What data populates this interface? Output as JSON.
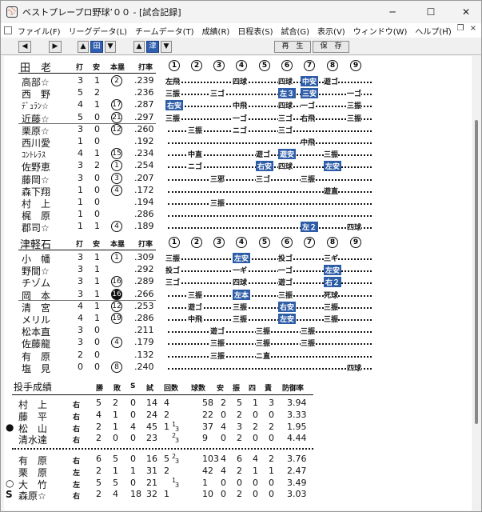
{
  "window": {
    "title": "ベストプレープロ野球’００ - [試合記録]",
    "icon": "baseball-cap-icon"
  },
  "menu": [
    "ファイル(F)",
    "リーグデータ(L)",
    "チームデータ(T)",
    "成績(R)",
    "日程表(S)",
    "試合(G)",
    "表示(V)",
    "ウィンドウ(W)",
    "ヘルプ(H)"
  ],
  "toolbar": {
    "team_a": "田",
    "team_b": "津",
    "replay": "再　生",
    "save": "保　存"
  },
  "headers": {
    "bat": "打",
    "hit": "安",
    "hr": "本塁",
    "avg": "打率"
  },
  "innings": [
    "1",
    "2",
    "3",
    "4",
    "5",
    "6",
    "7",
    "8",
    "9"
  ],
  "team_a": {
    "name": "田　老",
    "players": [
      {
        "name": "高部☆",
        "ab": "3",
        "h": "1",
        "hr": "2",
        "avg": ".239"
      },
      {
        "name": "西　野",
        "ab": "5",
        "h": "2",
        "hr": "",
        "avg": ".236"
      },
      {
        "name": "ﾃﾞｭﾗﾝ☆",
        "ab": "4",
        "h": "1",
        "hr": "17",
        "avg": ".287"
      },
      {
        "name": "近藤☆",
        "ab": "5",
        "h": "0",
        "hr": "21",
        "avg": ".297"
      },
      {
        "name": "栗原☆",
        "ab": "3",
        "h": "0",
        "hr": "12",
        "avg": ".260"
      },
      {
        "name": "西川愛",
        "ab": "1",
        "h": "0",
        "hr": "",
        "avg": ".192"
      },
      {
        "name": "ｺﾝﾄﾚﾗｽ",
        "ab": "4",
        "h": "1",
        "hr": "15",
        "avg": ".234"
      },
      {
        "name": "佐野恵",
        "ab": "3",
        "h": "2",
        "hr": "1",
        "avg": ".254"
      },
      {
        "name": "藤岡☆",
        "ab": "3",
        "h": "0",
        "hr": "3",
        "avg": ".207"
      },
      {
        "name": "森下翔",
        "ab": "1",
        "h": "0",
        "hr": "4",
        "avg": ".172"
      },
      {
        "name": "村　上",
        "ab": "1",
        "h": "0",
        "hr": "",
        "avg": ".194"
      },
      {
        "name": "梶　原",
        "ab": "1",
        "h": "0",
        "hr": "",
        "avg": ".286"
      },
      {
        "name": "郡司☆",
        "ab": "1",
        "h": "1",
        "hr": "4",
        "avg": ".189"
      }
    ]
  },
  "team_a_results": [
    [
      [
        "左飛",
        1,
        0
      ],
      [
        "四球",
        4,
        0
      ],
      [
        "四球",
        6,
        0
      ],
      [
        "中安",
        7,
        1
      ],
      [
        "遊ゴ",
        8,
        0
      ]
    ],
    [
      [
        "三振",
        1,
        0
      ],
      [
        "三ゴ",
        3,
        0
      ],
      [
        "左３",
        6,
        1
      ],
      [
        "三安",
        7,
        1
      ],
      [
        "一ゴ",
        9,
        0
      ]
    ],
    [
      [
        "右安",
        1,
        1
      ],
      [
        "中飛",
        4,
        0
      ],
      [
        "四球",
        6,
        0
      ],
      [
        "一ゴ",
        7,
        0
      ],
      [
        "三振",
        9,
        0
      ]
    ],
    [
      [
        "三振",
        1,
        0
      ],
      [
        "一ゴ",
        4,
        0
      ],
      [
        "三ゴ",
        6,
        0
      ],
      [
        "右飛",
        7,
        0
      ],
      [
        "三振",
        9,
        0
      ]
    ],
    [
      [
        "三振",
        2,
        0
      ],
      [
        "ニゴ",
        4,
        0
      ],
      [
        "三ゴ",
        6,
        0
      ]
    ],
    [
      [
        "中飛",
        7,
        0
      ]
    ],
    [
      [
        "中直",
        2,
        0
      ],
      [
        "遊ゴ",
        5,
        0
      ],
      [
        "遊安",
        6,
        1
      ],
      [
        "三振",
        8,
        0
      ]
    ],
    [
      [
        "ニゴ",
        2,
        0
      ],
      [
        "右安",
        5,
        1
      ],
      [
        "四球",
        6,
        0
      ],
      [
        "左安",
        8,
        1
      ]
    ],
    [
      [
        "三邪",
        3,
        0
      ],
      [
        "三ゴ",
        5,
        0
      ],
      [
        "三振",
        7,
        0
      ]
    ],
    [
      [
        "遊直",
        8,
        0
      ]
    ],
    [
      [
        "三振",
        3,
        0
      ]
    ],
    [],
    [
      [
        "左２",
        7,
        1
      ],
      [
        "四球",
        9,
        0
      ]
    ]
  ],
  "team_b": {
    "name": "津軽石",
    "players": [
      {
        "name": "小　幡",
        "ab": "3",
        "h": "1",
        "hr": "1",
        "avg": ".309",
        "hrBlack": false
      },
      {
        "name": "野間☆",
        "ab": "3",
        "h": "1",
        "hr": "",
        "avg": ".292",
        "hrBlack": false
      },
      {
        "name": "チゾム",
        "ab": "3",
        "h": "1",
        "hr": "16",
        "avg": ".289",
        "hrBlack": false
      },
      {
        "name": "岡　本",
        "ab": "3",
        "h": "1",
        "hr": "16",
        "avg": ".266",
        "hrBlack": true
      },
      {
        "name": "清　宮",
        "ab": "4",
        "h": "1",
        "hr": "12",
        "avg": ".253",
        "hrBlack": false
      },
      {
        "name": "メリル",
        "ab": "4",
        "h": "1",
        "hr": "19",
        "avg": ".286",
        "hrBlack": false
      },
      {
        "name": "松本直",
        "ab": "3",
        "h": "0",
        "hr": "",
        "avg": ".211",
        "hrBlack": false
      },
      {
        "name": "佐藤龍",
        "ab": "3",
        "h": "0",
        "hr": "4",
        "avg": ".179",
        "hrBlack": false
      },
      {
        "name": "有　原",
        "ab": "2",
        "h": "0",
        "hr": "",
        "avg": ".132",
        "hrBlack": false
      },
      {
        "name": "塩　見",
        "ab": "0",
        "h": "0",
        "hr": "8",
        "avg": ".240",
        "hrBlack": false
      }
    ]
  },
  "team_b_results": [
    [
      [
        "三振",
        1,
        0
      ],
      [
        "左安",
        4,
        1
      ],
      [
        "投ゴ",
        6,
        0
      ],
      [
        "三ギ",
        8,
        0
      ]
    ],
    [
      [
        "投ゴ",
        1,
        0
      ],
      [
        "一ギ",
        4,
        0
      ],
      [
        "一ゴ",
        6,
        0
      ],
      [
        "左安",
        8,
        1
      ]
    ],
    [
      [
        "三ゴ",
        1,
        0
      ],
      [
        "四球",
        4,
        0
      ],
      [
        "遊ゴ",
        6,
        0
      ],
      [
        "右２",
        8,
        1
      ]
    ],
    [
      [
        "三振",
        2,
        0
      ],
      [
        "左本",
        4,
        1
      ],
      [
        "三振",
        6,
        0
      ],
      [
        "死球",
        8,
        0
      ]
    ],
    [
      [
        "遊ゴ",
        2,
        0
      ],
      [
        "三振",
        4,
        0
      ],
      [
        "右安",
        6,
        1
      ],
      [
        "三振",
        8,
        0
      ]
    ],
    [
      [
        "中飛",
        2,
        0
      ],
      [
        "三振",
        4,
        0
      ],
      [
        "左安",
        6,
        1
      ],
      [
        "三振",
        8,
        0
      ]
    ],
    [
      [
        "遊ゴ",
        3,
        0
      ],
      [
        "三振",
        5,
        0
      ],
      [
        "三振",
        7,
        0
      ]
    ],
    [
      [
        "三振",
        3,
        0
      ],
      [
        "三振",
        5,
        0
      ],
      [
        "三振",
        7,
        0
      ]
    ],
    [
      [
        "三振",
        3,
        0
      ],
      [
        "ニ直",
        5,
        0
      ]
    ],
    [
      [
        "四球",
        9,
        0
      ]
    ]
  ],
  "pitching": {
    "title": "投手成績",
    "headers": [
      "勝",
      "敗",
      "S",
      "試",
      "回数",
      "球数",
      "安",
      "振",
      "四",
      "責",
      "防御率"
    ],
    "team_a": [
      {
        "mark": "",
        "name": "村　上",
        "hand": "右",
        "w": "5",
        "l": "2",
        "s": "0",
        "g": "14",
        "ip": "4",
        "frac": "",
        "pc": "58",
        "h": "2",
        "so": "5",
        "bb": "1",
        "er": "3",
        "era": "3.94"
      },
      {
        "mark": "",
        "name": "藤　平",
        "hand": "右",
        "w": "4",
        "l": "1",
        "s": "0",
        "g": "24",
        "ip": "2",
        "frac": "",
        "pc": "22",
        "h": "0",
        "so": "2",
        "bb": "0",
        "er": "0",
        "era": "3.33"
      },
      {
        "mark": "●",
        "name": "松　山",
        "hand": "右",
        "w": "2",
        "l": "1",
        "s": "4",
        "g": "45",
        "ip": "1",
        "frac": "1/3",
        "pc": "37",
        "h": "4",
        "so": "3",
        "bb": "2",
        "er": "2",
        "era": "1.95"
      },
      {
        "mark": "",
        "name": "清水達",
        "hand": "右",
        "w": "2",
        "l": "0",
        "s": "0",
        "g": "23",
        "ip": "",
        "frac": "2/3",
        "pc": "9",
        "h": "0",
        "so": "2",
        "bb": "0",
        "er": "0",
        "era": "4.44"
      }
    ],
    "team_b": [
      {
        "mark": "",
        "name": "有　原",
        "hand": "右",
        "w": "6",
        "l": "5",
        "s": "0",
        "g": "16",
        "ip": "5",
        "frac": "2/3",
        "pc": "103",
        "h": "4",
        "so": "6",
        "bb": "4",
        "er": "2",
        "era": "3.76"
      },
      {
        "mark": "",
        "name": "栗　原",
        "hand": "左",
        "w": "2",
        "l": "1",
        "s": "1",
        "g": "31",
        "ip": "2",
        "frac": "",
        "pc": "42",
        "h": "4",
        "so": "2",
        "bb": "1",
        "er": "1",
        "era": "2.47"
      },
      {
        "mark": "○",
        "name": "大　竹",
        "hand": "左",
        "w": "5",
        "l": "5",
        "s": "0",
        "g": "21",
        "ip": "",
        "frac": "1/3",
        "pc": "1",
        "h": "0",
        "so": "0",
        "bb": "0",
        "er": "0",
        "era": "3.49"
      },
      {
        "mark": "S",
        "name": "森原☆",
        "hand": "右",
        "w": "2",
        "l": "4",
        "s": "18",
        "g": "32",
        "ip": "1",
        "frac": "",
        "pc": "10",
        "h": "0",
        "so": "2",
        "bb": "0",
        "er": "0",
        "era": "3.03"
      }
    ]
  }
}
